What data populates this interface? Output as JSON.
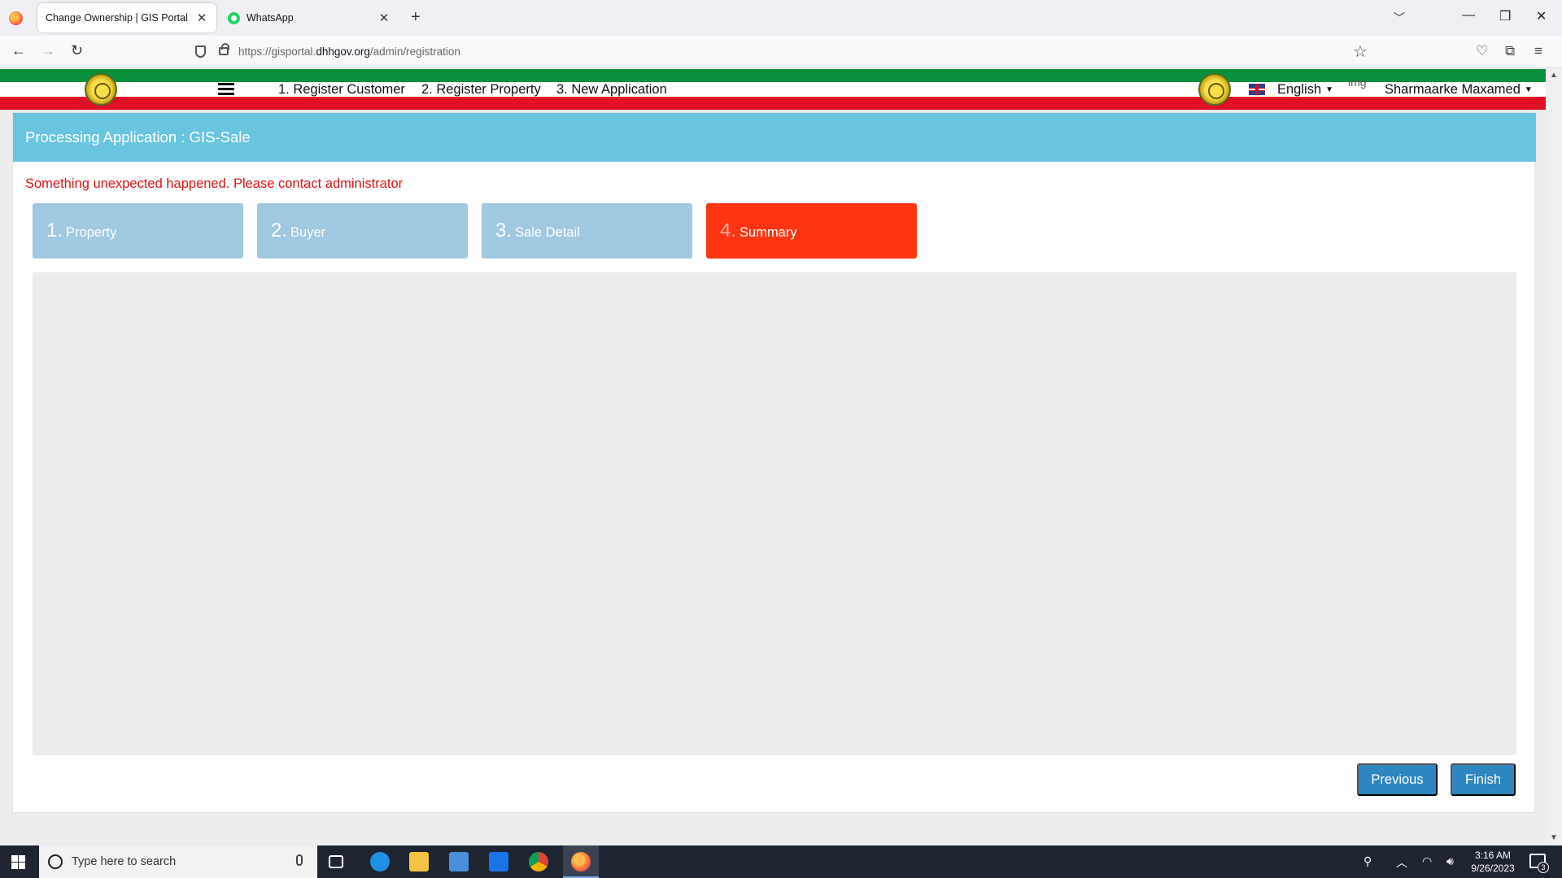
{
  "browser": {
    "tabs": [
      {
        "title": "Change Ownership | GIS Portal",
        "active": true
      },
      {
        "title": "WhatsApp",
        "active": false
      }
    ],
    "url_prefix": "https://gisportal.",
    "url_domain": "dhhgov.org",
    "url_path": "/admin/registration"
  },
  "header": {
    "nav": [
      "1. Register Customer",
      "2. Register Property",
      "3. New Application"
    ],
    "language": "English",
    "img_alt": "img",
    "user": "Sharmaarke Maxamed"
  },
  "panel": {
    "title": "Processing Application : GIS-Sale",
    "error": "Something unexpected happened. Please contact administrator",
    "steps": [
      {
        "num": "1.",
        "label": "Property"
      },
      {
        "num": "2.",
        "label": "Buyer"
      },
      {
        "num": "3.",
        "label": "Sale Detail"
      },
      {
        "num": "4.",
        "label": "Summary"
      }
    ],
    "current_step": 4,
    "buttons": {
      "previous": "Previous",
      "finish": "Finish"
    }
  },
  "taskbar": {
    "search_placeholder": "Type here to search",
    "time": "3:16 AM",
    "date": "9/26/2023",
    "notifications": "3"
  },
  "colors": {
    "header_blue": "#69c4e0",
    "step_inactive": "#a0c8e0",
    "step_active": "#ff3512",
    "button": "#2e86c1",
    "error": "#e11111",
    "flag_green": "#0a8f3c",
    "flag_red": "#df0f25"
  }
}
